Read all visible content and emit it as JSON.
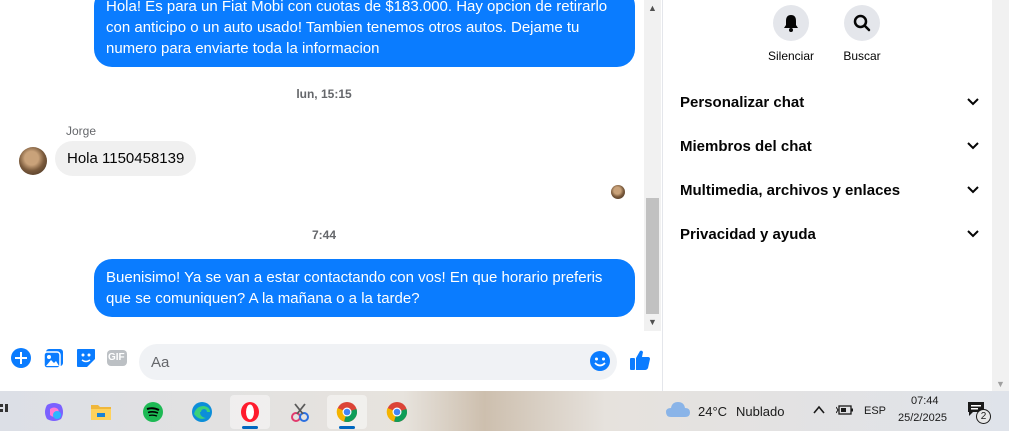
{
  "chat": {
    "messages": {
      "out1": "Hola! Es para un Fiat Mobi con cuotas de $183.000. Hay opcion de retirarlo con anticipo o un auto usado! Tambien tenemos otros autos. Dejame tu numero para enviarte toda la informacion",
      "timestamp1": "lun, 15:15",
      "sender_name": "Jorge",
      "in1": "Hola 1150458139",
      "timestamp2": "7:44",
      "out2": "Buenisimo! Ya se van a estar contactando con vos! En que horario preferis que se comuniquen? A la mañana o a la tarde?"
    },
    "composer": {
      "placeholder": "Aa",
      "gif_label": "GIF"
    }
  },
  "panel": {
    "mute_label": "Silenciar",
    "search_label": "Buscar",
    "sections": [
      "Personalizar chat",
      "Miembros del chat",
      "Multimedia, archivos y enlaces",
      "Privacidad y ayuda"
    ]
  },
  "taskbar": {
    "weather_temp": "24°C",
    "weather_text": "Nublado",
    "language": "ESP",
    "time": "07:44",
    "date": "25/2/2025",
    "notification_count": "2"
  },
  "colors": {
    "accent": "#0a7cff",
    "incoming_bubble": "#f0f0f0"
  }
}
